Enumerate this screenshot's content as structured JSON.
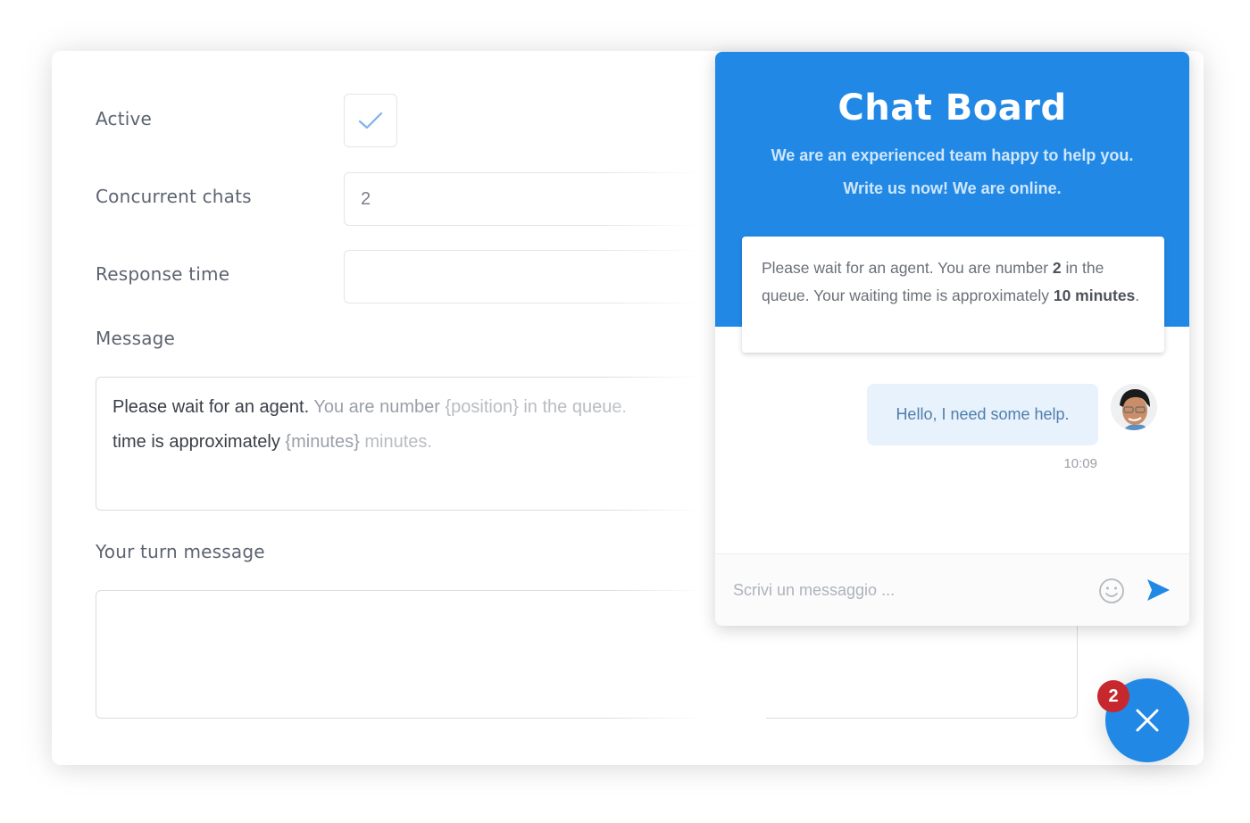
{
  "settings": {
    "active": {
      "label": "Active",
      "checked": true
    },
    "concurrent_chats": {
      "label": "Concurrent chats",
      "value": "2"
    },
    "response_time": {
      "label": "Response time",
      "value": ""
    },
    "message": {
      "label": "Message",
      "segments": [
        "Please wait for an agent.",
        " You are number ",
        "{position}",
        " in the queue.",
        "time is approximately ",
        "{minutes}",
        " minutes."
      ]
    },
    "your_turn_message": {
      "label": "Your turn message",
      "value": ""
    }
  },
  "chat": {
    "title": "Chat Board",
    "subtitle_line1": "We are an experienced team happy to help you.",
    "subtitle_line2": "Write us now! We are online.",
    "queue_notice": {
      "before": "Please wait for an agent. You are number ",
      "position": "2",
      "middle": " in the queue. Your waiting time is approximately ",
      "minutes": "10 minutes",
      "after": "."
    },
    "messages": [
      {
        "text": "Hello, I need some help.",
        "time": "10:09",
        "sender": "user"
      }
    ],
    "input_placeholder": "Scrivi un messaggio ...",
    "emoji_icon": "smiley-icon",
    "send_icon": "send-icon"
  },
  "launcher": {
    "badge_count": "2",
    "icon": "close-icon"
  },
  "colors": {
    "brand": "#2189e5",
    "badge": "#c6282e",
    "bubble": "#e8f2fd"
  }
}
